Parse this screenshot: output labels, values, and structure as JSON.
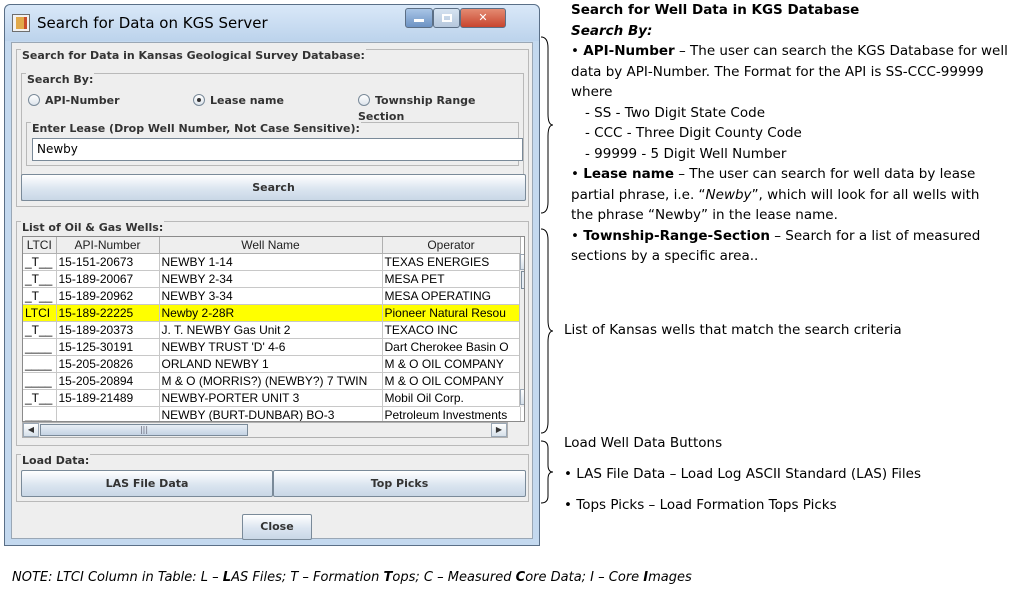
{
  "window": {
    "title": "Search for Data on KGS Server"
  },
  "search_panel": {
    "title": "Search for Data in Kansas Geological Survey Database:",
    "search_by_title": "Search By:",
    "options": [
      {
        "label": "API-Number",
        "selected": false
      },
      {
        "label": "Lease name",
        "selected": true
      },
      {
        "label": "Township Range Section",
        "selected": false
      }
    ],
    "lease_title": "Enter Lease (Drop Well Number, Not Case Sensitive):",
    "lease_value": "Newby",
    "search_button": "Search"
  },
  "wells": {
    "title": "List of Oil & Gas Wells:",
    "columns": [
      "LTCI",
      "API-Number",
      "Well Name",
      "Operator"
    ],
    "rows": [
      {
        "ltci": "_T__",
        "api": "15-151-20673",
        "name": "NEWBY 1-14",
        "operator": "TEXAS ENERGIES",
        "highlight": false
      },
      {
        "ltci": "_T__",
        "api": "15-189-20067",
        "name": "NEWBY 2-34",
        "operator": "MESA PET",
        "highlight": false
      },
      {
        "ltci": "_T__",
        "api": "15-189-20962",
        "name": "NEWBY 3-34",
        "operator": "MESA OPERATING",
        "highlight": false
      },
      {
        "ltci": "LTCI",
        "api": "15-189-22225",
        "name": "Newby 2-28R",
        "operator": "Pioneer Natural Resou",
        "highlight": true
      },
      {
        "ltci": "_T__",
        "api": "15-189-20373",
        "name": "J. T. NEWBY Gas Unit 2",
        "operator": "TEXACO INC",
        "highlight": false
      },
      {
        "ltci": "____",
        "api": "15-125-30191",
        "name": "NEWBY TRUST 'D' 4-6",
        "operator": "Dart Cherokee Basin O",
        "highlight": false
      },
      {
        "ltci": "____",
        "api": "15-205-20826",
        "name": "ORLAND NEWBY 1",
        "operator": "M & O OIL COMPANY",
        "highlight": false
      },
      {
        "ltci": "____",
        "api": "15-205-20894",
        "name": "M & O (MORRIS?) (NEWBY?) 7 TWIN",
        "operator": "M & O OIL COMPANY",
        "highlight": false
      },
      {
        "ltci": "_T__",
        "api": "15-189-21489",
        "name": "NEWBY-PORTER UNIT 3",
        "operator": "Mobil Oil Corp.",
        "highlight": false
      },
      {
        "ltci": "____",
        "api": "",
        "name": "NEWBY (BURT-DUNBAR) BO-3",
        "operator": "Petroleum Investments",
        "highlight": false
      }
    ]
  },
  "load_panel": {
    "title": "Load Data:",
    "las_button": "LAS File Data",
    "tops_button": "Top Picks"
  },
  "close_button": "Close",
  "annotations": {
    "search": {
      "heading": "Search for Well Data in KGS Database",
      "search_by": "Search By:",
      "api_title": "API-Number",
      "api_line1": " – The user can search the KGS Database for well",
      "api_line2": "data by API-Number.  The Format for the API is SS-CCC-99999",
      "api_line3": "where",
      "api_ss": "- SS - Two Digit State Code",
      "api_ccc": "- CCC - Three Digit County Code",
      "api_99999": "- 99999 - 5 Digit Well Number",
      "lease_title": "Lease name",
      "lease_line1": " – The user can search for well data by lease",
      "lease_line2_pre": "partial phrase, i.e. “",
      "lease_line2_em": "Newby",
      "lease_line2_post": "”, which will look for all wells with",
      "lease_line3": "the phrase “Newby” in the lease name.",
      "trs_title": "Township-Range-Section",
      "trs_line1": " – Search for a list of measured",
      "trs_line2": "sections by a specific area.."
    },
    "list": "List of Kansas wells that match the search criteria",
    "load": {
      "heading": "Load Well Data Buttons",
      "las": "LAS File Data – Load Log ASCII Standard (LAS) Files",
      "tops": "Tops Picks – Load Formation Tops Picks"
    },
    "note": {
      "p1": "NOTE: LTCI Column in Table: L – ",
      "b1": "L",
      "p2": "AS Files; T – Formation ",
      "b2": "T",
      "p3": "ops; C – Measured ",
      "b3": "C",
      "p4": "ore Data; I – Core ",
      "b4": "I",
      "p5": "mages"
    }
  }
}
